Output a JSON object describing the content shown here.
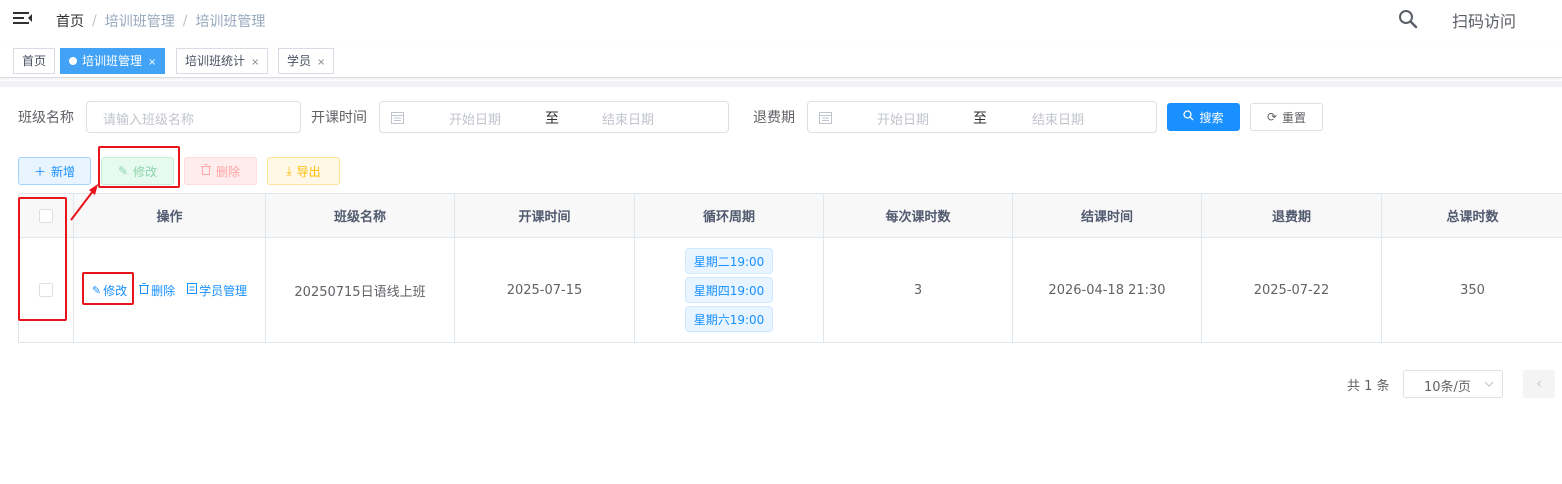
{
  "navbar": {
    "breadcrumb": [
      "首页",
      "培训班管理",
      "培训班管理"
    ],
    "scan_visit": "扫码访问"
  },
  "tags": [
    {
      "label": "首页",
      "active": false,
      "closable": false
    },
    {
      "label": "培训班管理",
      "active": true,
      "closable": true
    },
    {
      "label": "培训班统计",
      "active": false,
      "closable": true
    },
    {
      "label": "学员",
      "active": false,
      "closable": true
    }
  ],
  "search": {
    "class_name_label": "班级名称",
    "class_name_placeholder": "请输入班级名称",
    "start_time_label": "开课时间",
    "refund_label": "退费期",
    "start_date_placeholder": "开始日期",
    "end_date_placeholder": "结束日期",
    "range_separator": "至",
    "search_button": "搜索",
    "reset_button": "重置"
  },
  "toolbar": {
    "add": "新增",
    "edit": "修改",
    "delete": "删除",
    "export": "导出"
  },
  "table": {
    "columns": [
      "操作",
      "班级名称",
      "开课时间",
      "循环周期",
      "每次课时数",
      "结课时间",
      "退费期",
      "总课时数"
    ],
    "rows": [
      {
        "ops": {
          "edit": "修改",
          "delete": "删除",
          "students": "学员管理"
        },
        "class_name": "20250715日语线上班",
        "start_time": "2025-07-15",
        "cycle": [
          "星期二19:00",
          "星期四19:00",
          "星期六19:00"
        ],
        "hours_per_class": "3",
        "end_time": "2026-04-18 21:30",
        "refund_period": "2025-07-22",
        "total_hours": "350"
      }
    ]
  },
  "pagination": {
    "total": "共 1 条",
    "page_size": "10条/页"
  },
  "colors": {
    "primary": "#1890ff",
    "annotation_red": "#e8141b",
    "active_tag": "#42a2f5"
  }
}
